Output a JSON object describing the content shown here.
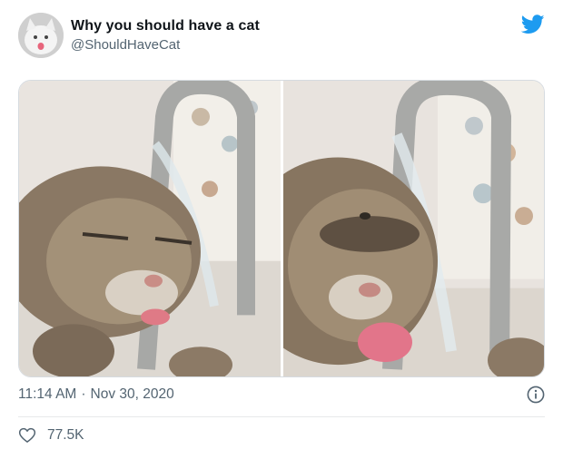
{
  "tweet": {
    "display_name": "Why you should have a cat",
    "handle": "@ShouldHaveCat",
    "time": "11:14 AM",
    "date": "Nov 30, 2020",
    "separator": "·",
    "likes": "77.5K"
  },
  "icons": {
    "brand": "twitter-bird-icon",
    "info": "info-icon",
    "like": "heart-icon"
  },
  "colors": {
    "twitter_blue": "#1d9bf0",
    "secondary_text": "#536471",
    "divider": "#e7e9ea"
  }
}
